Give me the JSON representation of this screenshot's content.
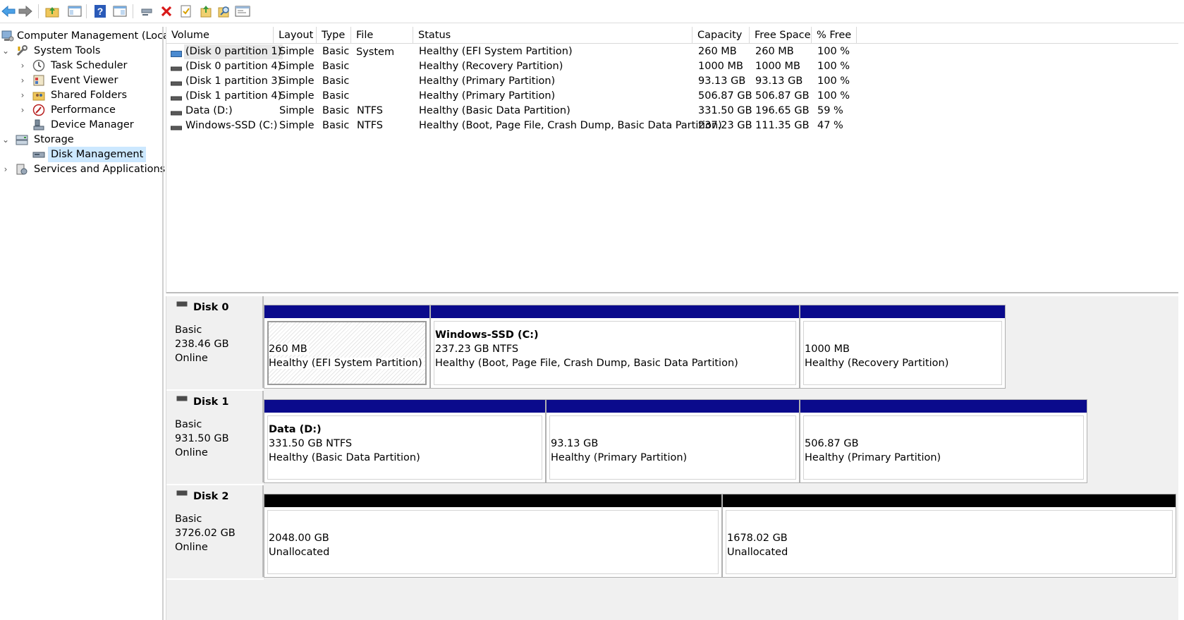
{
  "toolbar": {
    "buttons": [
      "back-icon",
      "forward-icon",
      "up-folder-icon",
      "show-hide-tree-icon",
      "help-icon",
      "properties-pane-icon",
      "connect-icon",
      "delete-icon",
      "properties-icon",
      "import-icon",
      "search-icon",
      "console-icon"
    ]
  },
  "tree": {
    "root": "Computer Management (Local)",
    "items": [
      {
        "label": "System Tools",
        "level": 1,
        "expanded": true
      },
      {
        "label": "Task Scheduler",
        "level": 2,
        "expanded": false
      },
      {
        "label": "Event Viewer",
        "level": 2,
        "expanded": false
      },
      {
        "label": "Shared Folders",
        "level": 2,
        "expanded": false
      },
      {
        "label": "Performance",
        "level": 2,
        "expanded": false
      },
      {
        "label": "Device Manager",
        "level": 2
      },
      {
        "label": "Storage",
        "level": 1,
        "expanded": true
      },
      {
        "label": "Disk Management",
        "level": 2,
        "selected": true
      },
      {
        "label": "Services and Applications",
        "level": 1,
        "expanded": false
      }
    ]
  },
  "volumes": {
    "columns": [
      "Volume",
      "Layout",
      "Type",
      "File System",
      "Status",
      "Capacity",
      "Free Space",
      "% Free"
    ],
    "rows": [
      {
        "volume": "(Disk 0 partition 1)",
        "layout": "Simple",
        "type": "Basic",
        "fs": "",
        "status": "Healthy (EFI System Partition)",
        "capacity": "260 MB",
        "free": "260 MB",
        "pct": "100 %"
      },
      {
        "volume": "(Disk 0 partition 4)",
        "layout": "Simple",
        "type": "Basic",
        "fs": "",
        "status": "Healthy (Recovery Partition)",
        "capacity": "1000 MB",
        "free": "1000 MB",
        "pct": "100 %"
      },
      {
        "volume": "(Disk 1 partition 3)",
        "layout": "Simple",
        "type": "Basic",
        "fs": "",
        "status": "Healthy (Primary Partition)",
        "capacity": "93.13 GB",
        "free": "93.13 GB",
        "pct": "100 %"
      },
      {
        "volume": "(Disk 1 partition 4)",
        "layout": "Simple",
        "type": "Basic",
        "fs": "",
        "status": "Healthy (Primary Partition)",
        "capacity": "506.87 GB",
        "free": "506.87 GB",
        "pct": "100 %"
      },
      {
        "volume": "Data (D:)",
        "layout": "Simple",
        "type": "Basic",
        "fs": "NTFS",
        "status": "Healthy (Basic Data Partition)",
        "capacity": "331.50 GB",
        "free": "196.65 GB",
        "pct": "59 %"
      },
      {
        "volume": "Windows-SSD (C:)",
        "layout": "Simple",
        "type": "Basic",
        "fs": "NTFS",
        "status": "Healthy (Boot, Page File, Crash Dump, Basic Data Partition)",
        "capacity": "237.23 GB",
        "free": "111.35 GB",
        "pct": "47 %"
      }
    ]
  },
  "disks": [
    {
      "name": "Disk 0",
      "type": "Basic",
      "size": "238.46 GB",
      "status": "Online",
      "partitions": [
        {
          "title": "",
          "line1": "260 MB",
          "line2": "Healthy (EFI System Partition)",
          "style": "efi"
        },
        {
          "title": "Windows-SSD  (C:)",
          "line1": "237.23 GB NTFS",
          "line2": "Healthy (Boot, Page File, Crash Dump, Basic Data Partition)",
          "style": "primary"
        },
        {
          "title": "",
          "line1": "1000 MB",
          "line2": "Healthy (Recovery Partition)",
          "style": "primary"
        }
      ]
    },
    {
      "name": "Disk 1",
      "type": "Basic",
      "size": "931.50 GB",
      "status": "Online",
      "partitions": [
        {
          "title": "Data  (D:)",
          "line1": "331.50 GB NTFS",
          "line2": "Healthy (Basic Data Partition)",
          "style": "primary"
        },
        {
          "title": "",
          "line1": "93.13 GB",
          "line2": "Healthy (Primary Partition)",
          "style": "primary"
        },
        {
          "title": "",
          "line1": "506.87 GB",
          "line2": "Healthy (Primary Partition)",
          "style": "primary"
        }
      ]
    },
    {
      "name": "Disk 2",
      "type": "Basic",
      "size": "3726.02 GB",
      "status": "Online",
      "partitions": [
        {
          "title": "",
          "line1": "2048.00 GB",
          "line2": "Unallocated",
          "style": "unallocated"
        },
        {
          "title": "",
          "line1": "1678.02 GB",
          "line2": "Unallocated",
          "style": "unallocated"
        }
      ]
    }
  ],
  "colors": {
    "primary_bar": "#0a0a8c",
    "unallocated_bar": "#000000",
    "selection": "#cce8ff"
  }
}
